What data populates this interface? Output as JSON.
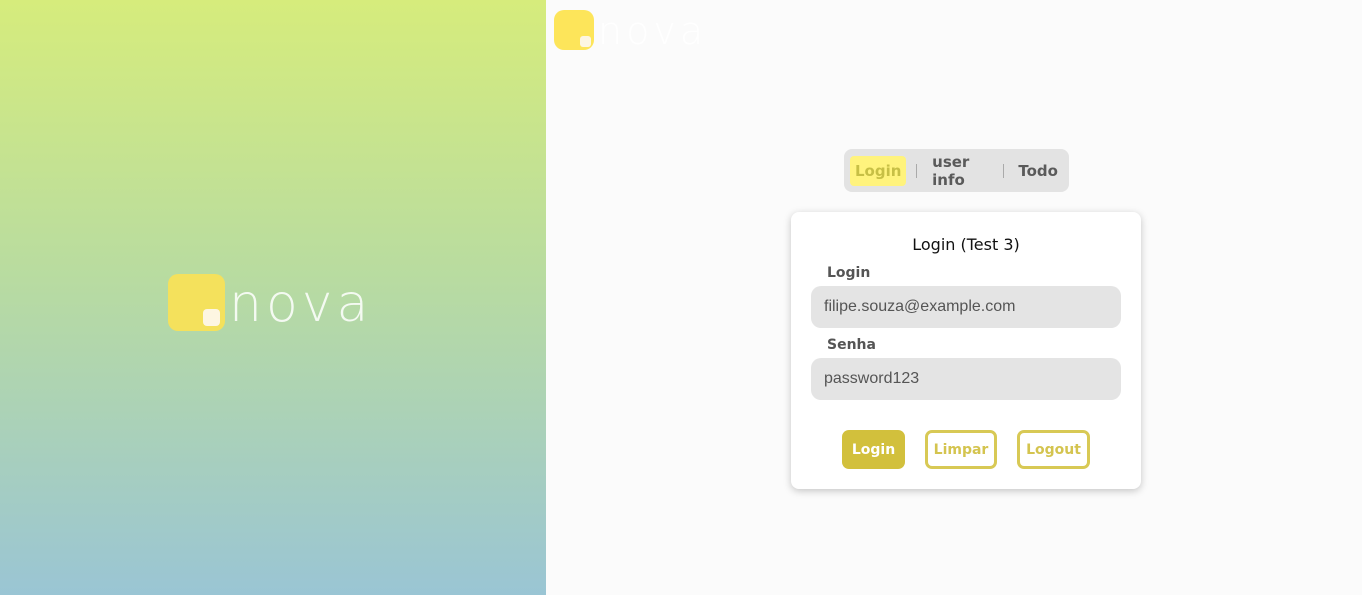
{
  "brand": {
    "name": "nova"
  },
  "nav": {
    "items": [
      {
        "label": "Login",
        "active": true
      },
      {
        "label": "user info",
        "active": false
      },
      {
        "label": "Todo",
        "active": false
      }
    ]
  },
  "form": {
    "title": "Login (Test 3)",
    "login_label": "Login",
    "login_value": "filipe.souza@example.com",
    "password_label": "Senha",
    "password_value": "password123",
    "buttons": {
      "login": "Login",
      "clear": "Limpar",
      "logout": "Logout"
    }
  },
  "colors": {
    "accent": "#d2c03c",
    "nav_active_bg": "#fff37d",
    "logo_yellow": "#f4e15c"
  }
}
